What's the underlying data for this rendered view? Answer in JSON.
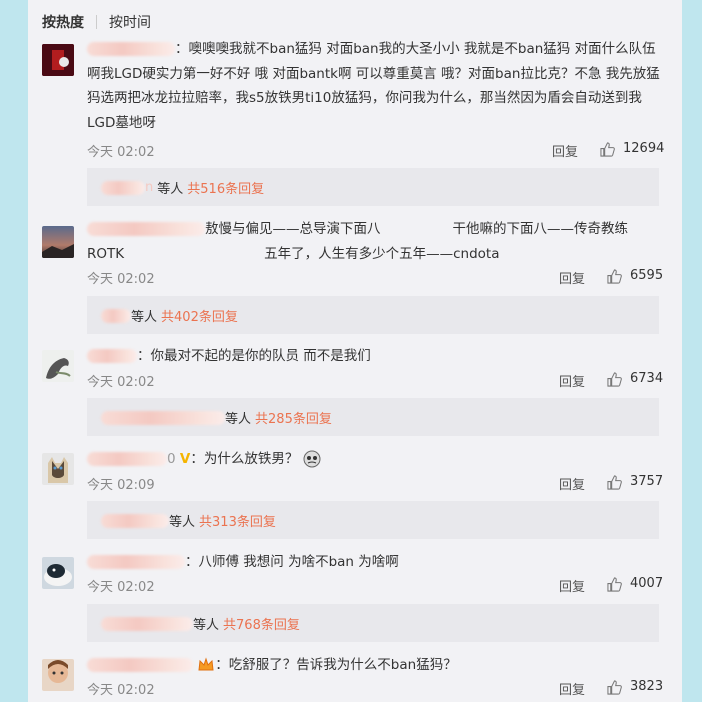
{
  "tabs": {
    "hot": "按热度",
    "time": "按时间"
  },
  "labels": {
    "reply": "回复",
    "waiting": "等人",
    "total_prefix": "共",
    "total_suffix": "条回复"
  },
  "comments": [
    {
      "text": "：噢噢噢我就不ban猛犸 对面ban我的大圣小小 我就是不ban猛犸 对面什么队伍啊我LGD硬实力第一好不好  哦 对面bantk啊 可以尊重莫言 哦？对面ban拉比克？不急 我先放猛犸选两把冰龙拉拉赔率，我s5放铁男ti10放猛犸，你问我为什么，那当然因为盾会自动送到我LGD墓地呀",
      "time": "今天 02:02",
      "likes": "12694",
      "sub_partial": "n",
      "sub_count": "516"
    },
    {
      "text_a": "敖慢与偏见——总导演下面八",
      "text_b": "干他嘛的下面八——传奇教练",
      "text_c": "ROTK",
      "text_d": "五年了，人生有多少个五年——cndota",
      "time": "今天 02:02",
      "likes": "6595",
      "sub_count": "402"
    },
    {
      "text": "：你最对不起的是你的队员 而不是我们",
      "time": "今天 02:02",
      "likes": "6734",
      "sub_count": "285"
    },
    {
      "name_tail": "0",
      "text": "：为什么放铁男？",
      "time": "今天 02:09",
      "likes": "3757",
      "sub_count": "313"
    },
    {
      "text": "：八师傅 我想问 为啥不ban 为啥啊",
      "time": "今天 02:02",
      "likes": "4007",
      "sub_count": "768"
    },
    {
      "text": "：吃舒服了？告诉我为什么不ban猛犸？",
      "time": "今天 02:02",
      "likes": "3823"
    }
  ]
}
